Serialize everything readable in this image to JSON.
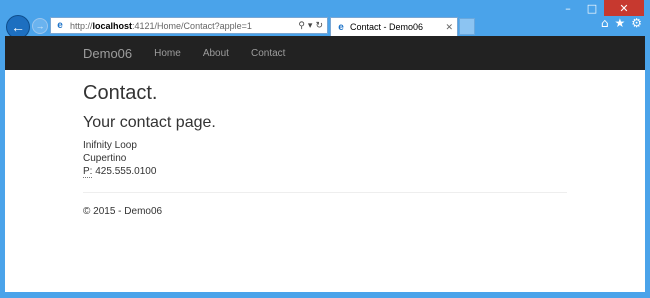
{
  "browser": {
    "address": {
      "url_prefix": "http://",
      "url_host": "localhost",
      "url_rest": ":4121/Home/Contact?apple=1"
    },
    "tab": {
      "title": "Contact - Demo06"
    },
    "icons": [
      "back-icon",
      "forward-icon",
      "ie-icon",
      "search-icon",
      "refresh-icon",
      "home-icon",
      "favorites-icon",
      "settings-icon"
    ]
  },
  "navbar": {
    "brand": "Demo06",
    "links": [
      "Home",
      "About",
      "Contact"
    ]
  },
  "page": {
    "title": "Contact.",
    "subtitle": "Your contact page.",
    "address": {
      "line1": "Inifnity Loop",
      "line2": "Cupertino",
      "phone_label": "P:",
      "phone": "425.555.0100"
    },
    "footer": "© 2015 - Demo06"
  },
  "colors": {
    "frame": "#4aa3ea",
    "navbar": "#222222",
    "close": "#c7392f"
  }
}
